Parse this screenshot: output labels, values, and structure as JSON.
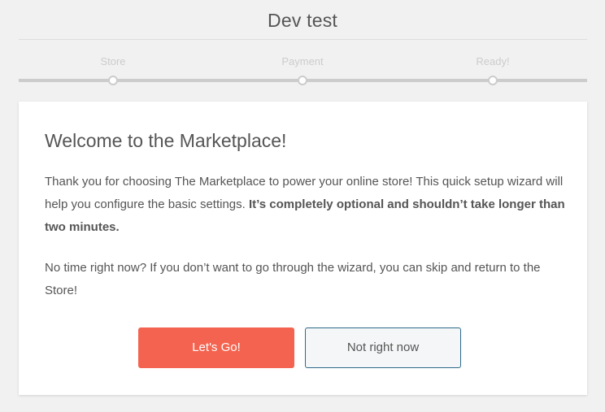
{
  "header": {
    "site_title": "Dev test"
  },
  "steps": [
    {
      "label": "Store"
    },
    {
      "label": "Payment"
    },
    {
      "label": "Ready!"
    }
  ],
  "card": {
    "heading": "Welcome to the Marketplace!",
    "intro_text": "Thank you for choosing The Marketplace to power your online store! This quick setup wizard will help you configure the basic settings. ",
    "intro_bold": "It’s completely optional and shouldn’t take longer than two minutes.",
    "skip_text": "No time right now? If you don’t want to go through the wizard, you can skip and return to the Store!"
  },
  "buttons": {
    "primary_label": "Let's Go!",
    "secondary_label": "Not right now"
  },
  "colors": {
    "primary_button": "#f4634f",
    "secondary_border": "#2c6a8a",
    "background": "#f1f1f1",
    "step_inactive": "#cccccc"
  }
}
